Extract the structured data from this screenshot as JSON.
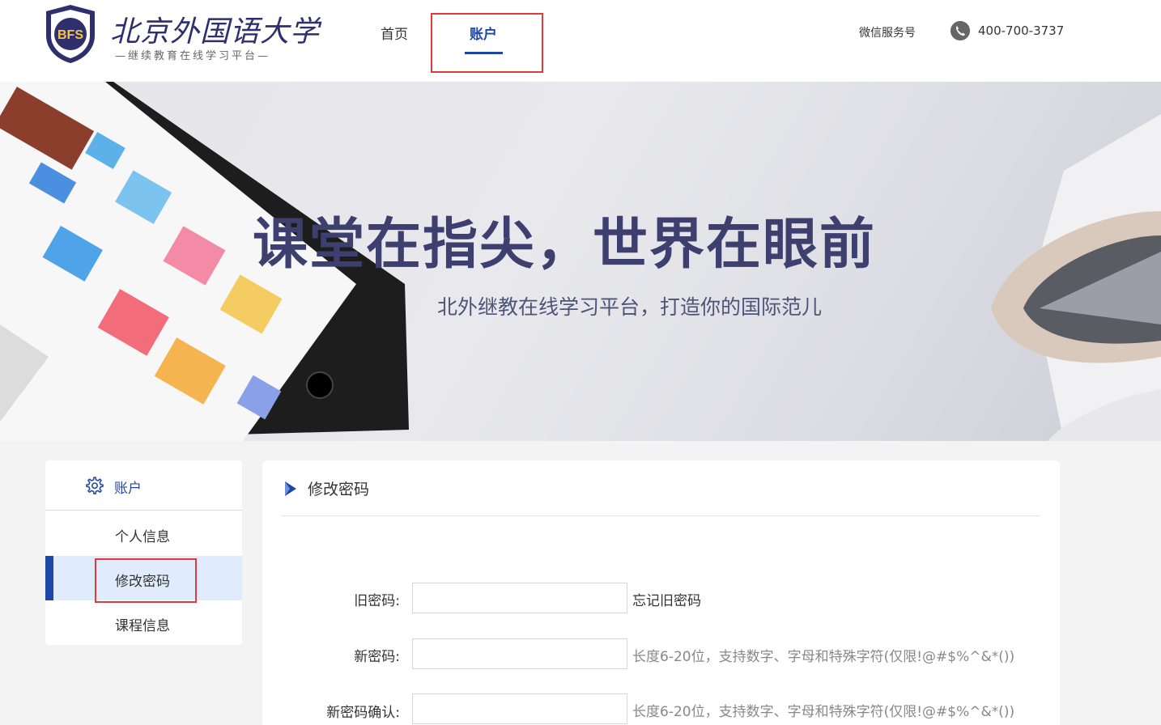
{
  "header": {
    "logo": {
      "name": "北京外国语大学",
      "subtitle": "—继续教育在线学习平台—",
      "emblem_text": "BFS"
    },
    "nav": [
      {
        "label": "首页",
        "active": false
      },
      {
        "label": "账户",
        "active": true
      }
    ],
    "wechat": "微信服务号",
    "phone": "400-700-3737"
  },
  "banner": {
    "headline": "课堂在指尖，世界在眼前",
    "subline": "北外继教在线学习平台，打造你的国际范儿"
  },
  "sidebar": {
    "title": "账户",
    "items": [
      {
        "label": "个人信息",
        "active": false
      },
      {
        "label": "修改密码",
        "active": true
      },
      {
        "label": "课程信息",
        "active": false
      }
    ]
  },
  "panel": {
    "title": "修改密码",
    "fields": [
      {
        "label": "旧密码:",
        "value": "",
        "side_text": "忘记旧密码"
      },
      {
        "label": "新密码:",
        "value": "",
        "side_text": "长度6-20位，支持数字、字母和特殊字符(仅限!@#$%^&*())"
      },
      {
        "label": "新密码确认:",
        "value": "",
        "side_text": "长度6-20位，支持数字、字母和特殊字符(仅限!@#$%^&*())"
      }
    ]
  },
  "colors": {
    "accent": "#1e46a8",
    "highlight": "#e03b3b",
    "active_bg": "#e0ecfb"
  }
}
